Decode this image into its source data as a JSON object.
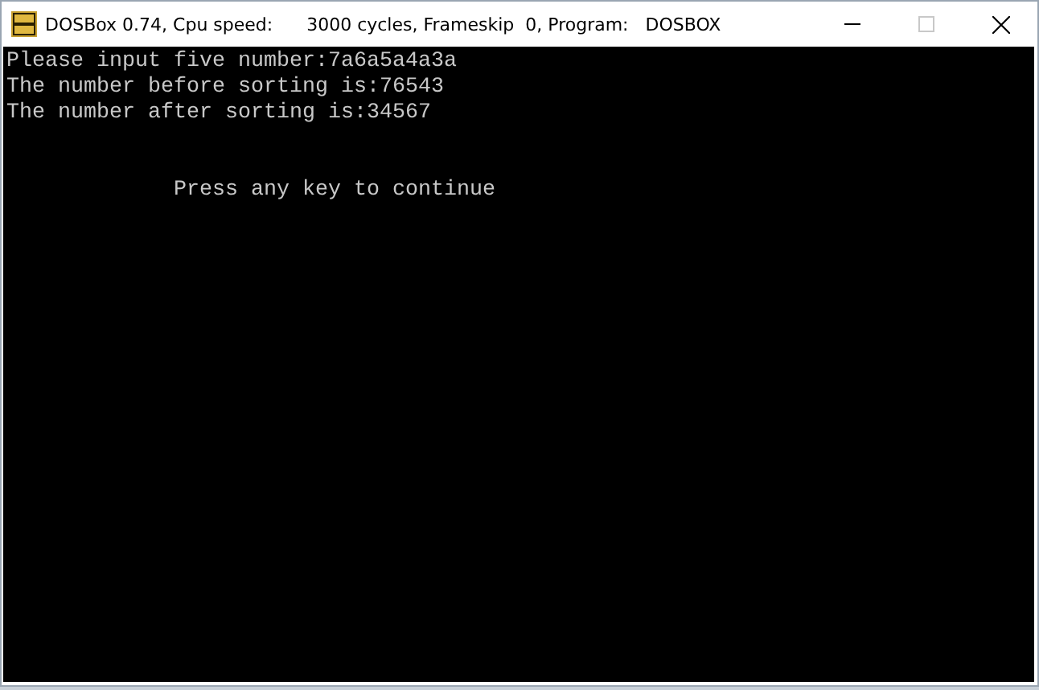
{
  "window": {
    "title": "DOSBox 0.74, Cpu speed:      3000 cycles, Frameskip  0, Program:   DOSBOX",
    "maximize_disabled": true
  },
  "console": {
    "lines": [
      {
        "kind": "text",
        "text": "Please input five number:7a6a5a4a3a"
      },
      {
        "kind": "text",
        "text": "The number before sorting is:76543"
      },
      {
        "kind": "text",
        "text": "The number after sorting is:34567"
      },
      {
        "kind": "blank"
      },
      {
        "kind": "blank"
      },
      {
        "kind": "indented",
        "text": "Press any key to continue"
      }
    ]
  }
}
